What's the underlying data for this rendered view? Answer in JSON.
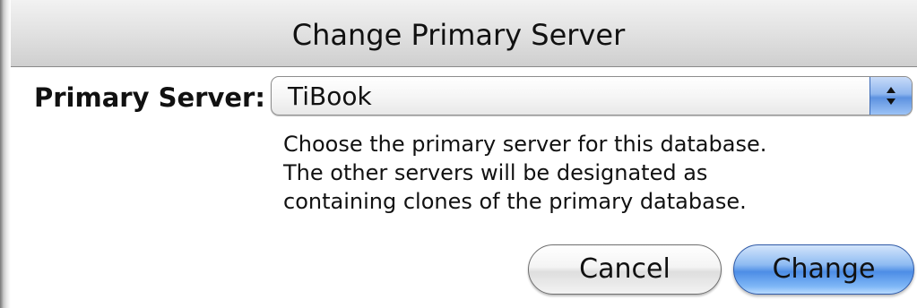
{
  "dialog": {
    "title": "Change Primary Server"
  },
  "primary_server": {
    "label": "Primary Server:",
    "selected_value": "TiBook"
  },
  "help_text": {
    "lines": [
      "Choose the primary server for this database.",
      "The other servers will be designated as",
      "containing clones of the primary database."
    ]
  },
  "buttons": {
    "cancel_label": "Cancel",
    "change_label": "Change"
  },
  "colors": {
    "default_button": "#4d8de6",
    "popup_arrows": "#5d92e0"
  },
  "icons": {
    "popup_arrows": "up-down-arrows-icon"
  }
}
